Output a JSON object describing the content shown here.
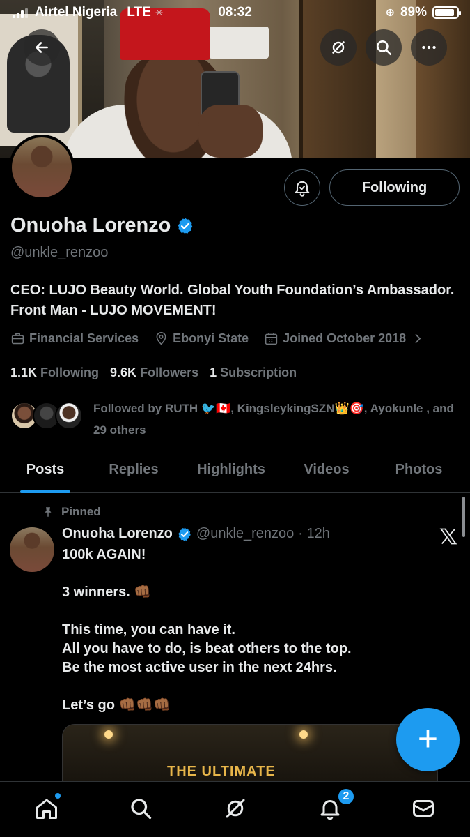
{
  "status_bar": {
    "carrier": "Airtel Nigeria",
    "network": "LTE",
    "time": "08:32",
    "battery": "89%",
    "battery_level": 0.89
  },
  "header": {
    "back_icon": "arrow-left-icon",
    "grok_icon": "grok-icon",
    "search_icon": "search-icon",
    "more_icon": "more-horizontal-icon"
  },
  "profile": {
    "name": "Onuoha Lorenzo",
    "handle": "@unkle_renzoo",
    "follow_button": "Following",
    "bio": "CEO: LUJO Beauty World. Global Youth Foundation’s Ambassador. Front Man - LUJO MOVEMENT!",
    "category": "Financial Services",
    "location": "Ebonyi State",
    "joined": "Joined October 2018",
    "following_count": "1.1K",
    "following_label": "Following",
    "followers_count": "9.6K",
    "followers_label": "Followers",
    "subscription_count": "1",
    "subscription_label": "Subscription",
    "followed_by": "Followed by RUTH 🐦🇨🇦, KingsleykingSZN👑🎯, Ayokunle , and 29 others"
  },
  "tabs": [
    {
      "label": "Posts",
      "active": true
    },
    {
      "label": "Replies",
      "active": false
    },
    {
      "label": "Highlights",
      "active": false
    },
    {
      "label": "Videos",
      "active": false
    },
    {
      "label": "Photos",
      "active": false
    }
  ],
  "post": {
    "pinned_label": "Pinned",
    "author_name": "Onuoha Lorenzo",
    "author_handle": "@unkle_renzoo",
    "time": "· 12h",
    "text": "100k AGAIN!\n\n3 winners. 👊🏾\n\nThis time, you can have it.\nAll you have to do, is beat others to the top.\nBe the most active user in the next 24hrs.\n\nLet’s go 👊🏾👊🏾👊🏾",
    "media_text": "THE ULTIMATE"
  },
  "fab": {
    "label": "+"
  },
  "bottom_nav": {
    "items": [
      "home-icon",
      "search-icon",
      "grok-icon",
      "notifications-icon",
      "messages-icon"
    ],
    "notifications_badge": "2"
  },
  "colors": {
    "accent": "#1d9bf0",
    "muted": "#71767b",
    "text": "#e7e9ea",
    "background": "#000000"
  }
}
